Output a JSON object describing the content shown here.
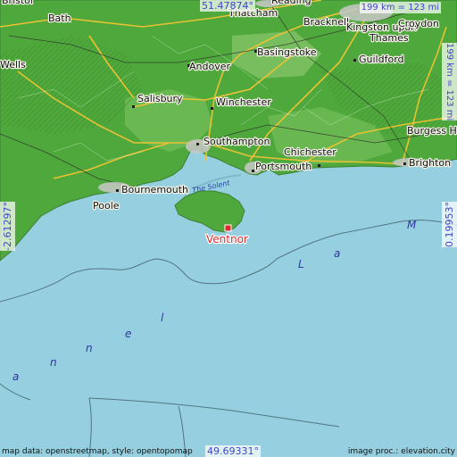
{
  "map": {
    "lat_top": "51.47874°",
    "lat_bottom": "49.69331°",
    "lon_left": "-2.61297°",
    "lon_right": "0.19953°",
    "scale_top": "199 km = 123 mi",
    "scale_right": "199 km = 123 mi",
    "credit_left": "map data: openstreetmap, style: opentopomap",
    "credit_right": "image proc.: elevation.city",
    "highlight": "Ventnor",
    "places": [
      "Bristol",
      "Bath",
      "Wells",
      "Salisbury",
      "Andover",
      "Winchester",
      "Basingstoke",
      "Thatcham",
      "Reading",
      "Bracknell",
      "Kingston upon Thames",
      "Croydon",
      "Guildford",
      "Southampton",
      "Portsmouth",
      "Chichester",
      "Brighton",
      "Burgess Hill",
      "Bournemouth",
      "Poole",
      "Ventnor"
    ],
    "waterway": "The Solent",
    "sea_letters": [
      "a",
      "n",
      "n",
      "e",
      "l",
      "L",
      "a",
      "M"
    ],
    "colors": {
      "sea": "#96d0e0",
      "land": "#4fa83c",
      "highlight": "#e3282c"
    }
  }
}
